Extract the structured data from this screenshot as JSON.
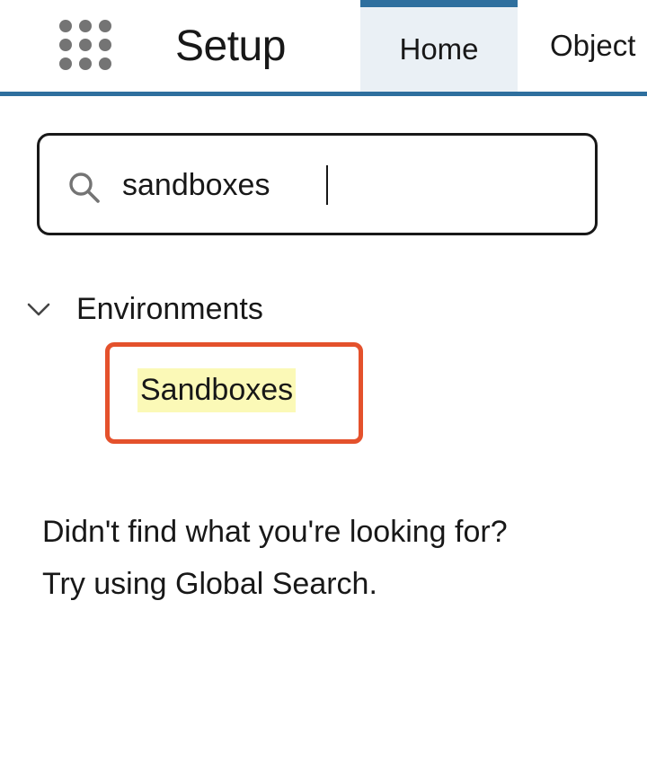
{
  "header": {
    "app_title": "Setup",
    "app_launcher_icon": "waffle-grid-icon",
    "tabs": [
      {
        "label": "Home",
        "active": true
      },
      {
        "label": "Object"
      }
    ],
    "accent_color": "#2e6f9e"
  },
  "search": {
    "icon": "search-icon",
    "value": "sandboxes"
  },
  "results": {
    "group": {
      "icon": "chevron-down-icon",
      "label": "Environments",
      "expanded": true
    },
    "items": [
      {
        "label": "Sandboxes",
        "highlight_color": "#fbf9b7"
      }
    ],
    "callout_color": "#e4512c"
  },
  "help": {
    "line1": "Didn't find what you're looking for?",
    "line2": "Try using Global Search."
  }
}
